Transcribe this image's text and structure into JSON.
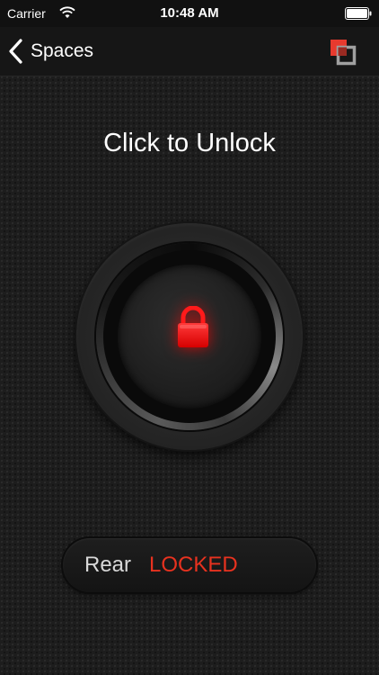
{
  "status_bar": {
    "carrier": "Carrier",
    "time": "10:48 AM"
  },
  "nav": {
    "back_label": "Spaces"
  },
  "main": {
    "title": "Click to Unlock",
    "lock_state": "locked"
  },
  "door": {
    "name": "Rear",
    "state": "LOCKED"
  },
  "icons": {
    "back": "chevron-left-icon",
    "logo": "overlapping-squares-logo-icon",
    "lock": "padlock-icon",
    "wifi": "wifi-icon",
    "battery": "battery-icon"
  },
  "colors": {
    "accent_red": "#ff1a1a",
    "state_red": "#e8321f",
    "logo_red": "#e83a2e",
    "logo_gray": "#a0a0a0"
  }
}
